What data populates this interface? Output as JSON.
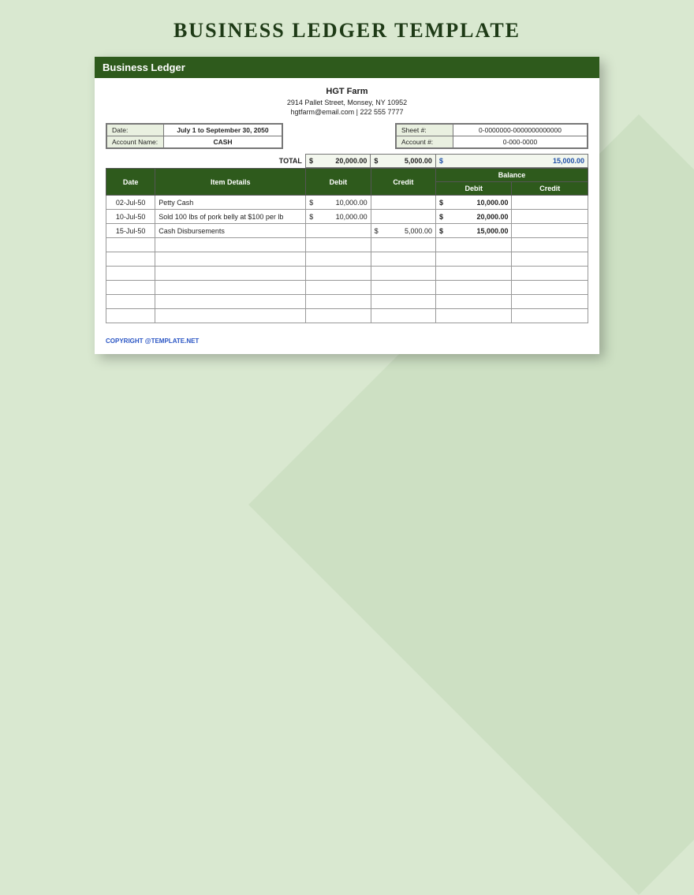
{
  "page_title": "BUSINESS LEDGER TEMPLATE",
  "sheet_title": "Business Ledger",
  "company": {
    "name": "HGT Farm",
    "address": "2914 Pallet Street, Monsey, NY 10952",
    "contact": "hgtfarm@email.com | 222 555 7777"
  },
  "meta_left": {
    "date_label": "Date:",
    "date_value": "July 1 to September 30, 2050",
    "account_name_label": "Account Name:",
    "account_name_value": "CASH"
  },
  "meta_right": {
    "sheet_label": "Sheet #:",
    "sheet_value": "0-0000000-0000000000000",
    "account_label": "Account #:",
    "account_value": "0-000-0000"
  },
  "totals": {
    "label": "TOTAL",
    "debit": "20,000.00",
    "credit": "5,000.00",
    "balance": "15,000.00",
    "currency": "$"
  },
  "columns": {
    "date": "Date",
    "item": "Item Details",
    "debit": "Debit",
    "credit": "Credit",
    "balance": "Balance",
    "balance_debit": "Debit",
    "balance_credit": "Credit"
  },
  "rows": [
    {
      "date": "02-Jul-50",
      "item": "Petty Cash",
      "debit": "10,000.00",
      "credit": "",
      "bal_debit": "10,000.00",
      "bal_credit": ""
    },
    {
      "date": "10-Jul-50",
      "item": "Sold 100 lbs of pork belly at $100 per lb",
      "debit": "10,000.00",
      "credit": "",
      "bal_debit": "20,000.00",
      "bal_credit": ""
    },
    {
      "date": "15-Jul-50",
      "item": "Cash Disbursements",
      "debit": "",
      "credit": "5,000.00",
      "bal_debit": "15,000.00",
      "bal_credit": ""
    },
    {
      "date": "",
      "item": "",
      "debit": "",
      "credit": "",
      "bal_debit": "",
      "bal_credit": ""
    },
    {
      "date": "",
      "item": "",
      "debit": "",
      "credit": "",
      "bal_debit": "",
      "bal_credit": ""
    },
    {
      "date": "",
      "item": "",
      "debit": "",
      "credit": "",
      "bal_debit": "",
      "bal_credit": ""
    },
    {
      "date": "",
      "item": "",
      "debit": "",
      "credit": "",
      "bal_debit": "",
      "bal_credit": ""
    },
    {
      "date": "",
      "item": "",
      "debit": "",
      "credit": "",
      "bal_debit": "",
      "bal_credit": ""
    },
    {
      "date": "",
      "item": "",
      "debit": "",
      "credit": "",
      "bal_debit": "",
      "bal_credit": ""
    }
  ],
  "currency": "$",
  "copyright": "COPYRIGHT @TEMPLATE.NET"
}
